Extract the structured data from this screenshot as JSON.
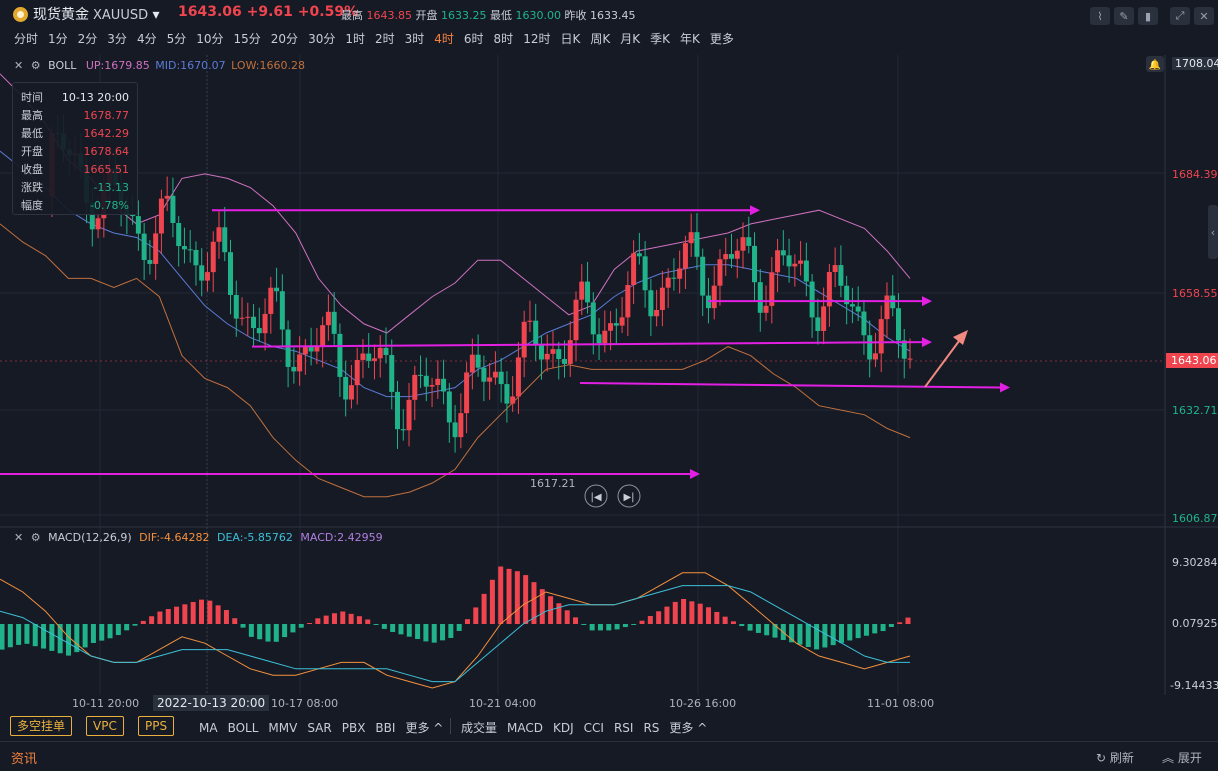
{
  "header": {
    "name": "现货黄金",
    "symbol": "XAUUSD",
    "price": "1643.06",
    "change": "+9.61",
    "change_pct": "+0.59%",
    "high_label": "最高",
    "high": "1643.85",
    "open_label": "开盘",
    "open": "1633.25",
    "low_label": "最低",
    "low": "1630.00",
    "prev_close_label": "昨收",
    "prev_close": "1633.45"
  },
  "timeframes": [
    "分时",
    "1分",
    "2分",
    "3分",
    "4分",
    "5分",
    "10分",
    "15分",
    "20分",
    "30分",
    "1时",
    "2时",
    "3时",
    "4时",
    "6时",
    "8时",
    "12时",
    "日K",
    "周K",
    "月K",
    "季K",
    "年K",
    "更多"
  ],
  "active_timeframe": "4时",
  "boll": {
    "label": "BOLL",
    "up": "UP:1679.85",
    "mid": "MID:1670.07",
    "low": "LOW:1660.28"
  },
  "tooltip": [
    {
      "k": "时间",
      "v": "10-13 20:00",
      "c": "#e6e9ef"
    },
    {
      "k": "最高",
      "v": "1678.77",
      "c": "#f0454f"
    },
    {
      "k": "最低",
      "v": "1642.29",
      "c": "#f0454f"
    },
    {
      "k": "开盘",
      "v": "1678.64",
      "c": "#f0454f"
    },
    {
      "k": "收盘",
      "v": "1665.51",
      "c": "#f0454f"
    },
    {
      "k": "涨跌",
      "v": "-13.13",
      "c": "#20b38a"
    },
    {
      "k": "幅度",
      "v": "-0.78%",
      "c": "#20b38a"
    }
  ],
  "price_axis": {
    "top": "1708.04",
    "ticks": [
      "1684.39",
      "1658.55",
      "1632.71",
      "1606.87"
    ],
    "current": "1643.06"
  },
  "min_marker": "1617.21",
  "macd": {
    "label": "MACD(12,26,9)",
    "dif": "DIF:-4.64282",
    "dea": "DEA:-5.85762",
    "macd": "MACD:2.42959",
    "axis": [
      "9.30284",
      "0.07925",
      "-9.14433"
    ]
  },
  "time_axis": [
    "10-11 20:00",
    "10-17 08:00",
    "10-21 04:00",
    "10-26 16:00",
    "11-01 08:00"
  ],
  "time_cursor": "2022-10-13 20:00",
  "chips": [
    "多空挂单",
    "VPC",
    "PPS"
  ],
  "main_indicators": [
    "MA",
    "BOLL",
    "MMV",
    "SAR",
    "PBX",
    "BBI",
    "更多 ^"
  ],
  "sub_indicators": [
    "成交量",
    "MACD",
    "KDJ",
    "CCI",
    "RSI",
    "RS",
    "更多 ^"
  ],
  "footer": {
    "news": "资讯",
    "refresh": "刷新",
    "expand": "展开"
  },
  "colors": {
    "up": "#f0454f",
    "down": "#20b38a",
    "upper_band": "#d071c1",
    "mid_band": "#5b7bd6",
    "lower_band": "#c0703d",
    "line": "#e31fe3",
    "dif": "#f5913d",
    "dea": "#3cc0d8"
  },
  "chart_data": {
    "type": "candlestick",
    "ylim": [
      1606.87,
      1708.04
    ],
    "boll_upper": [
      1705,
      1700,
      1694,
      1686,
      1682,
      1676,
      1672,
      1674,
      1682,
      1683,
      1682,
      1680,
      1676,
      1670,
      1660,
      1654,
      1650,
      1648,
      1652,
      1656,
      1659,
      1664,
      1664,
      1660,
      1656,
      1652,
      1654,
      1662,
      1666,
      1667,
      1668,
      1669,
      1670,
      1672,
      1673,
      1674,
      1675,
      1673,
      1671,
      1666,
      1660
    ],
    "boll_mid": [
      1688,
      1684,
      1680,
      1675,
      1672,
      1670,
      1669,
      1666,
      1660,
      1654,
      1650,
      1647,
      1645,
      1644,
      1642,
      1640,
      1636,
      1634,
      1634,
      1635,
      1636,
      1640,
      1642,
      1645,
      1648,
      1650,
      1652,
      1656,
      1659,
      1661,
      1662,
      1663,
      1663,
      1662,
      1661,
      1660,
      1657,
      1654,
      1651,
      1647,
      1644
    ],
    "boll_lower": [
      1672,
      1668,
      1665,
      1660,
      1660,
      1658,
      1660,
      1656,
      1643,
      1638,
      1636,
      1632,
      1625,
      1620,
      1616,
      1614,
      1612,
      1612,
      1613,
      1615,
      1618,
      1625,
      1630,
      1635,
      1640,
      1641,
      1640,
      1640,
      1640,
      1640,
      1640,
      1642,
      1645,
      1643,
      1639,
      1636,
      1632,
      1631,
      1630,
      1627,
      1625
    ],
    "macd_dif": [
      7,
      5,
      2,
      -2,
      -5,
      -6,
      -6,
      -4,
      -2,
      -3,
      -5,
      -7,
      -8,
      -8,
      -7,
      -6,
      -6,
      -8,
      -9,
      -10,
      -9,
      -5,
      0,
      3,
      5,
      4,
      3,
      3,
      4,
      6,
      8,
      8,
      6,
      3,
      0,
      -3,
      -5,
      -6,
      -7,
      -6,
      -5
    ],
    "macd_dea": [
      2,
      1,
      -1,
      -3,
      -5,
      -6,
      -6,
      -5,
      -4,
      -4,
      -4,
      -5,
      -6,
      -7,
      -7,
      -7,
      -7,
      -7,
      -8,
      -9,
      -9,
      -6,
      -3,
      0,
      2,
      3,
      3,
      3,
      4,
      5,
      6,
      6,
      6,
      5,
      3,
      1,
      -1,
      -3,
      -5,
      -6,
      -6
    ],
    "macd_hist": [
      -4,
      -3,
      -4,
      -5,
      -3,
      -2,
      0,
      2,
      3,
      4,
      2,
      -2,
      -3,
      -1,
      1,
      2,
      1,
      -1,
      -2,
      -3,
      -2,
      3,
      9,
      8,
      5,
      2,
      -1,
      -1,
      0,
      2,
      4,
      3,
      1,
      -1,
      -2,
      -3,
      -4,
      -3,
      -2,
      -1,
      1
    ]
  }
}
